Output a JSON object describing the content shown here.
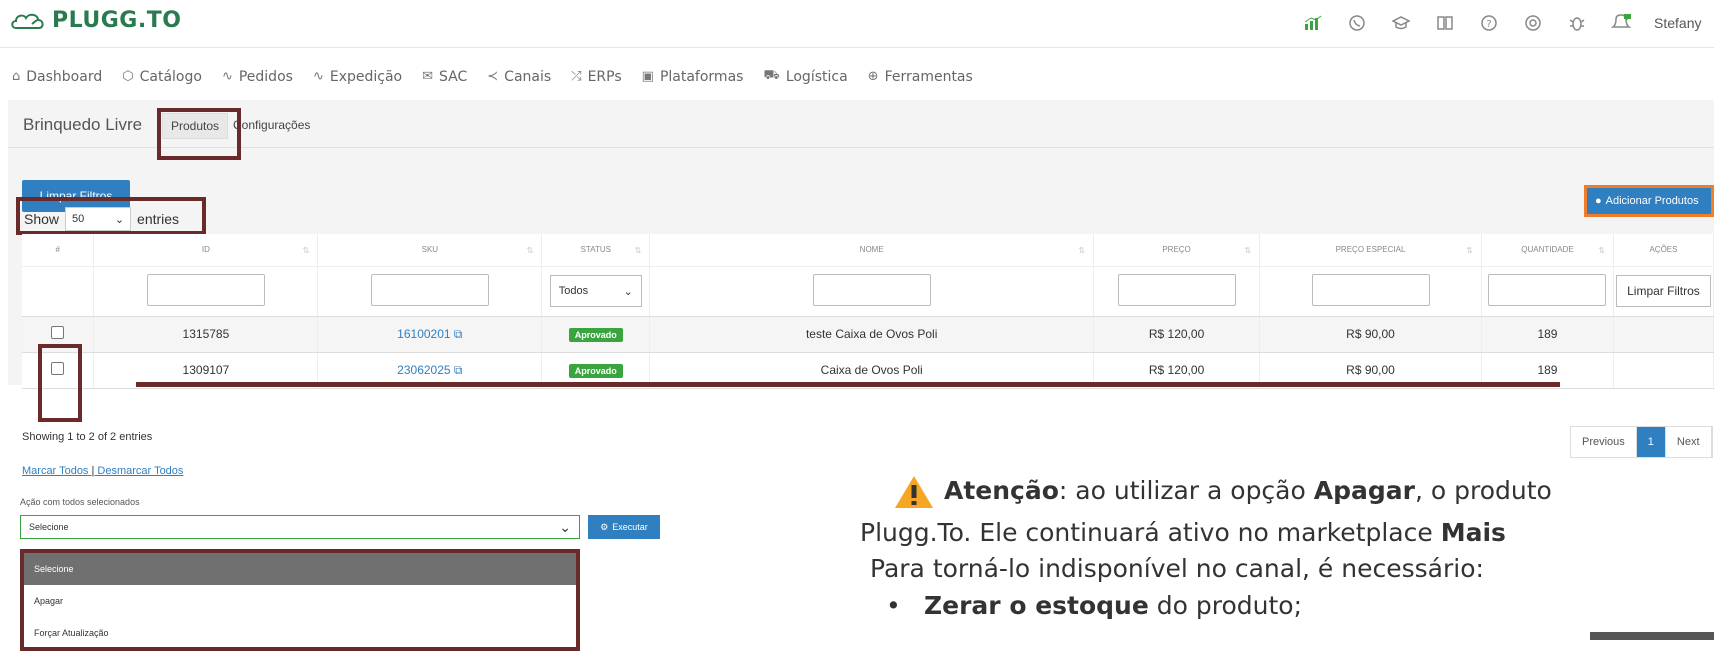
{
  "app": {
    "logo_text": "PLUGG.TO",
    "user_name": "Stefany"
  },
  "top_icons": [
    "analytics-icon",
    "whatsapp-icon",
    "graduation-icon",
    "book-icon",
    "help-icon",
    "support-icon",
    "bug-icon",
    "notification-icon"
  ],
  "nav": [
    {
      "label": "Dashboard",
      "icon": "home-icon"
    },
    {
      "label": "Catálogo",
      "icon": "box-icon"
    },
    {
      "label": "Pedidos",
      "icon": "pulse-icon"
    },
    {
      "label": "Expedição",
      "icon": "pulse-icon"
    },
    {
      "label": "SAC",
      "icon": "mail-icon"
    },
    {
      "label": "Canais",
      "icon": "share-icon"
    },
    {
      "label": "ERPs",
      "icon": "shuffle-icon"
    },
    {
      "label": "Plataformas",
      "icon": "calendar-icon"
    },
    {
      "label": "Logística",
      "icon": "truck-icon"
    },
    {
      "label": "Ferramentas",
      "icon": "plus-circle-icon"
    }
  ],
  "subnav": {
    "store": "Brinquedo Livre",
    "tab_products": "Produtos",
    "tab_settings": "Configurações"
  },
  "toolbar": {
    "clear_filters": "Limpar Filtros",
    "add_products": "Adicionar Produtos"
  },
  "show_entries": {
    "prefix": "Show",
    "value": "50",
    "suffix": "entries"
  },
  "table": {
    "headers": [
      "#",
      "ID",
      "SKU",
      "STATUS",
      "NOME",
      "PREÇO",
      "PREÇO ESPECIAL",
      "QUANTIDADE",
      "AÇÕES"
    ],
    "status_filter": "Todos",
    "clear_filters_btn": "Limpar Filtros",
    "rows": [
      {
        "id": "1315785",
        "sku": "16100201",
        "status": "Aprovado",
        "name": "teste Caixa de Ovos Poli",
        "price": "R$ 120,00",
        "special_price": "R$ 90,00",
        "qty": "189"
      },
      {
        "id": "1309107",
        "sku": "23062025",
        "status": "Aprovado",
        "name": "Caixa de Ovos Poli",
        "price": "R$ 120,00",
        "special_price": "R$ 90,00",
        "qty": "189"
      }
    ]
  },
  "showing_text": "Showing 1 to 2 of 2 entries",
  "select_links": {
    "select_all": "Marcar Todos",
    "separator": "|",
    "deselect_all": "Desmarcar Todos"
  },
  "pager": {
    "prev": "Previous",
    "page": "1",
    "next": "Next"
  },
  "bulk": {
    "label": "Ação com todos selecionados",
    "selected": "Selecione",
    "execute": "Executar",
    "options": [
      "Selecione",
      "Apagar",
      "Forçar Atualização"
    ]
  },
  "note": {
    "l1_bold1": "Atenção",
    "l1_text1": ": ao utilizar a opção ",
    "l1_bold2": "Apagar",
    "l1_text2": ", o produto",
    "l2_text": "Plugg.To. Ele continuará ativo no marketplace ",
    "l2_bold": "Mais",
    "l3_text": "Para torná-lo indisponível no canal, é necessário:",
    "l4_bullet": "•",
    "l4_bold": "Zerar o estoque",
    "l4_text": " do produto;"
  },
  "colors": {
    "accent": "#2f7fc1",
    "highlight": "#6b2a2a",
    "success": "#3aa53e",
    "add_border": "#f07d2a"
  }
}
